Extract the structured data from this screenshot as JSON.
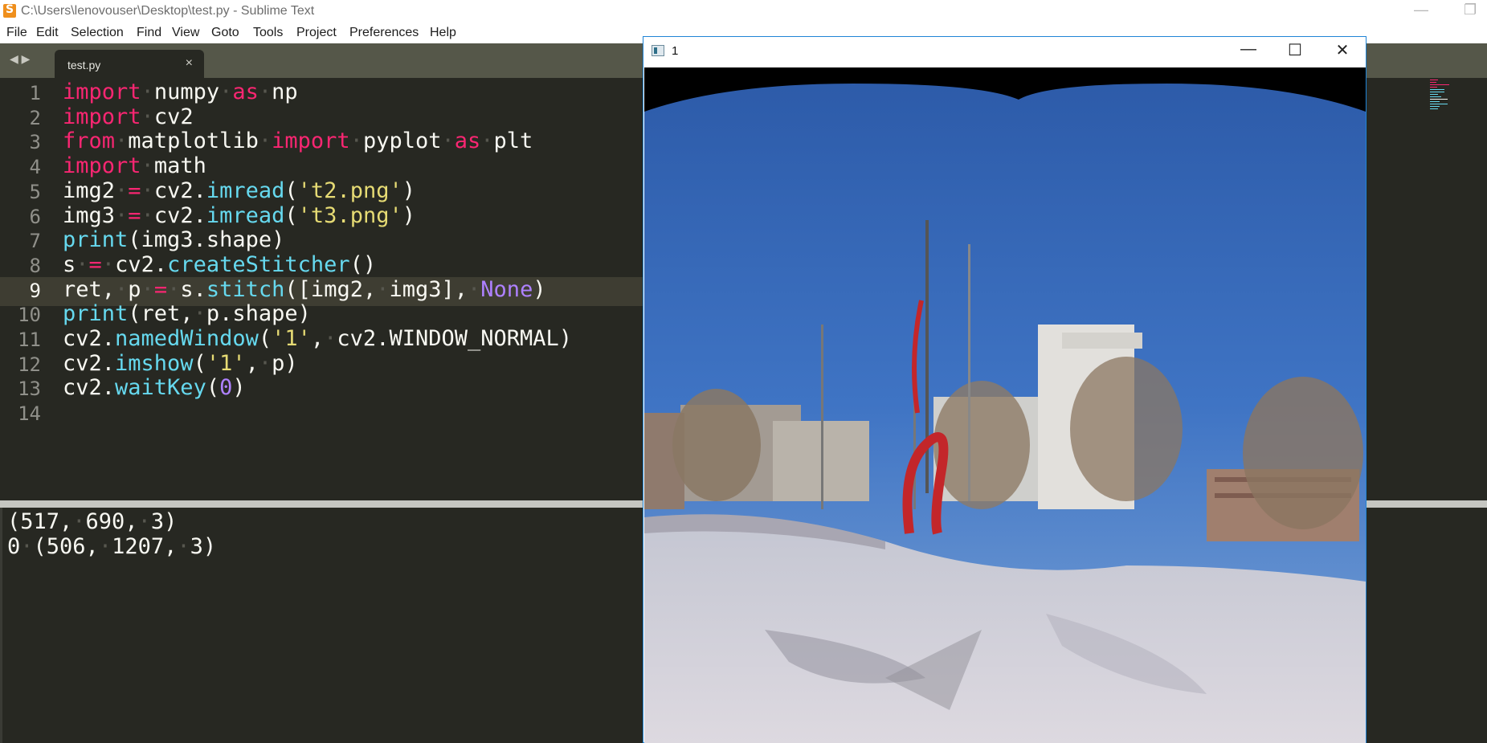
{
  "window": {
    "title": "C:\\Users\\lenovouser\\Desktop\\test.py - Sublime Text",
    "minimize_glyph": "—",
    "restore_glyph": "❐"
  },
  "menu": [
    "File",
    "Edit",
    "Selection",
    "Find",
    "View",
    "Goto",
    "Tools",
    "Project",
    "Preferences",
    "Help"
  ],
  "tabs": [
    {
      "label": "test.py",
      "close": "×"
    }
  ],
  "nav_arrows": "◀ ▶",
  "editor": {
    "active_line": 9,
    "lines": [
      {
        "n": "1",
        "tokens": [
          [
            "kw",
            "import"
          ],
          [
            "dt",
            "·"
          ],
          [
            "tx",
            "numpy"
          ],
          [
            "dt",
            "·"
          ],
          [
            "kw",
            "as"
          ],
          [
            "dt",
            "·"
          ],
          [
            "tx",
            "np"
          ]
        ]
      },
      {
        "n": "2",
        "tokens": [
          [
            "kw",
            "import"
          ],
          [
            "dt",
            "·"
          ],
          [
            "tx",
            "cv2"
          ]
        ]
      },
      {
        "n": "3",
        "tokens": [
          [
            "kw",
            "from"
          ],
          [
            "dt",
            "·"
          ],
          [
            "tx",
            "matplotlib"
          ],
          [
            "dt",
            "·"
          ],
          [
            "kw",
            "import"
          ],
          [
            "dt",
            "·"
          ],
          [
            "tx",
            "pyplot"
          ],
          [
            "dt",
            "·"
          ],
          [
            "kw",
            "as"
          ],
          [
            "dt",
            "·"
          ],
          [
            "tx",
            "plt"
          ]
        ]
      },
      {
        "n": "4",
        "tokens": [
          [
            "kw",
            "import"
          ],
          [
            "dt",
            "·"
          ],
          [
            "tx",
            "math"
          ]
        ]
      },
      {
        "n": "5",
        "tokens": [
          [
            "tx",
            "img2"
          ],
          [
            "dt",
            "·"
          ],
          [
            "kw",
            "="
          ],
          [
            "dt",
            "·"
          ],
          [
            "tx",
            "cv2."
          ],
          [
            "fn",
            "imread"
          ],
          [
            "tx",
            "("
          ],
          [
            "st",
            "'t2.png'"
          ],
          [
            "tx",
            ")"
          ]
        ]
      },
      {
        "n": "6",
        "tokens": [
          [
            "tx",
            "img3"
          ],
          [
            "dt",
            "·"
          ],
          [
            "kw",
            "="
          ],
          [
            "dt",
            "·"
          ],
          [
            "tx",
            "cv2."
          ],
          [
            "fn",
            "imread"
          ],
          [
            "tx",
            "("
          ],
          [
            "st",
            "'t3.png'"
          ],
          [
            "tx",
            ")"
          ]
        ]
      },
      {
        "n": "7",
        "tokens": [
          [
            "fn",
            "print"
          ],
          [
            "tx",
            "(img3.shape)"
          ]
        ]
      },
      {
        "n": "8",
        "tokens": [
          [
            "tx",
            "s"
          ],
          [
            "dt",
            "·"
          ],
          [
            "kw",
            "="
          ],
          [
            "dt",
            "·"
          ],
          [
            "tx",
            "cv2."
          ],
          [
            "fn",
            "createStitcher"
          ],
          [
            "tx",
            "()"
          ]
        ]
      },
      {
        "n": "9",
        "tokens": [
          [
            "tx",
            "ret,"
          ],
          [
            "dt",
            "·"
          ],
          [
            "tx",
            "p"
          ],
          [
            "dt",
            "·"
          ],
          [
            "kw",
            "="
          ],
          [
            "dt",
            "·"
          ],
          [
            "tx",
            "s."
          ],
          [
            "fn",
            "stitch"
          ],
          [
            "tx",
            "([img2,"
          ],
          [
            "dt",
            "·"
          ],
          [
            "tx",
            "img3],"
          ],
          [
            "dt",
            "·"
          ],
          [
            "nm",
            "None"
          ],
          [
            "tx",
            ")"
          ]
        ]
      },
      {
        "n": "10",
        "tokens": [
          [
            "fn",
            "print"
          ],
          [
            "tx",
            "(ret,"
          ],
          [
            "dt",
            "·"
          ],
          [
            "tx",
            "p.shape)"
          ]
        ]
      },
      {
        "n": "11",
        "tokens": [
          [
            "tx",
            "cv2."
          ],
          [
            "fn",
            "namedWindow"
          ],
          [
            "tx",
            "("
          ],
          [
            "st",
            "'1'"
          ],
          [
            "tx",
            ","
          ],
          [
            "dt",
            "·"
          ],
          [
            "tx",
            "cv2.WINDOW_NORMAL)"
          ]
        ]
      },
      {
        "n": "12",
        "tokens": [
          [
            "tx",
            "cv2."
          ],
          [
            "fn",
            "imshow"
          ],
          [
            "tx",
            "("
          ],
          [
            "st",
            "'1'"
          ],
          [
            "tx",
            ","
          ],
          [
            "dt",
            "·"
          ],
          [
            "tx",
            "p)"
          ]
        ]
      },
      {
        "n": "13",
        "tokens": [
          [
            "tx",
            "cv2."
          ],
          [
            "fn",
            "waitKey"
          ],
          [
            "tx",
            "("
          ],
          [
            "nm",
            "0"
          ],
          [
            "tx",
            ")"
          ]
        ]
      },
      {
        "n": "14",
        "tokens": []
      }
    ]
  },
  "output": {
    "lines": [
      [
        [
          "tx",
          "(517,"
        ],
        [
          "dt",
          "·"
        ],
        [
          "tx",
          "690,"
        ],
        [
          "dt",
          "·"
        ],
        [
          "tx",
          "3)"
        ]
      ],
      [
        [
          "tx",
          "0"
        ],
        [
          "dt",
          "·"
        ],
        [
          "tx",
          "(506,"
        ],
        [
          "dt",
          "·"
        ],
        [
          "tx",
          "1207,"
        ],
        [
          "dt",
          "·"
        ],
        [
          "tx",
          "3)"
        ]
      ]
    ]
  },
  "image_window": {
    "title": "1",
    "minimize_glyph": "—",
    "maximize_glyph": "☐",
    "close_glyph": "✕"
  },
  "colors": {
    "editor_bg": "#272822",
    "keyword": "#f92672",
    "function": "#66d9ef",
    "string": "#e6db74",
    "number": "#ae81ff",
    "window_border": "#1f84d6"
  }
}
